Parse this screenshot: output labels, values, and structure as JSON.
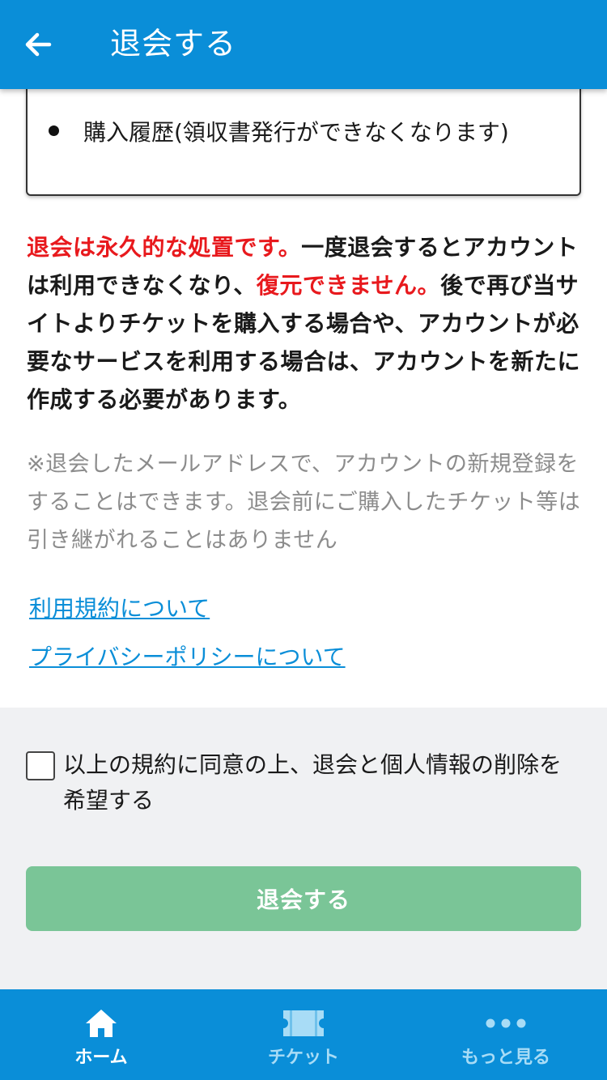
{
  "header": {
    "title": "退会する",
    "back_icon": "arrow-left-icon"
  },
  "card": {
    "item": "購入履歴(領収書発行ができなくなります)"
  },
  "notice": {
    "part1_red": "退会は永久的な処置です。",
    "part2": "一度退会するとアカウントは利用できなくなり、",
    "part3_red": "復元できません。",
    "part4": "後で再び当サイトよりチケットを購入する場合や、アカウントが必要なサービスを利用する場合は、アカウントを新たに作成する必要があります。"
  },
  "note": "※退会したメールアドレスで、アカウントの新規登録をすることはできます。退会前にご購入したチケット等は引き継がれることはありません",
  "links": {
    "terms": "利用規約について",
    "privacy": "プライバシーポリシーについて"
  },
  "agreement": {
    "label": "以上の規約に同意の上、退会と個人情報の削除を希望する",
    "checked": false
  },
  "submit_button": "退会する",
  "bottom_nav": {
    "items": [
      {
        "label": "ホーム",
        "icon": "home-icon",
        "active": true
      },
      {
        "label": "チケット",
        "icon": "ticket-icon",
        "active": false
      },
      {
        "label": "もっと見る",
        "icon": "more-dots-icon",
        "active": false
      }
    ]
  },
  "colors": {
    "primary": "#0a8ed8",
    "danger": "#e8191d",
    "button_disabled": "#7ac597",
    "section_bg": "#f0f1f3"
  }
}
